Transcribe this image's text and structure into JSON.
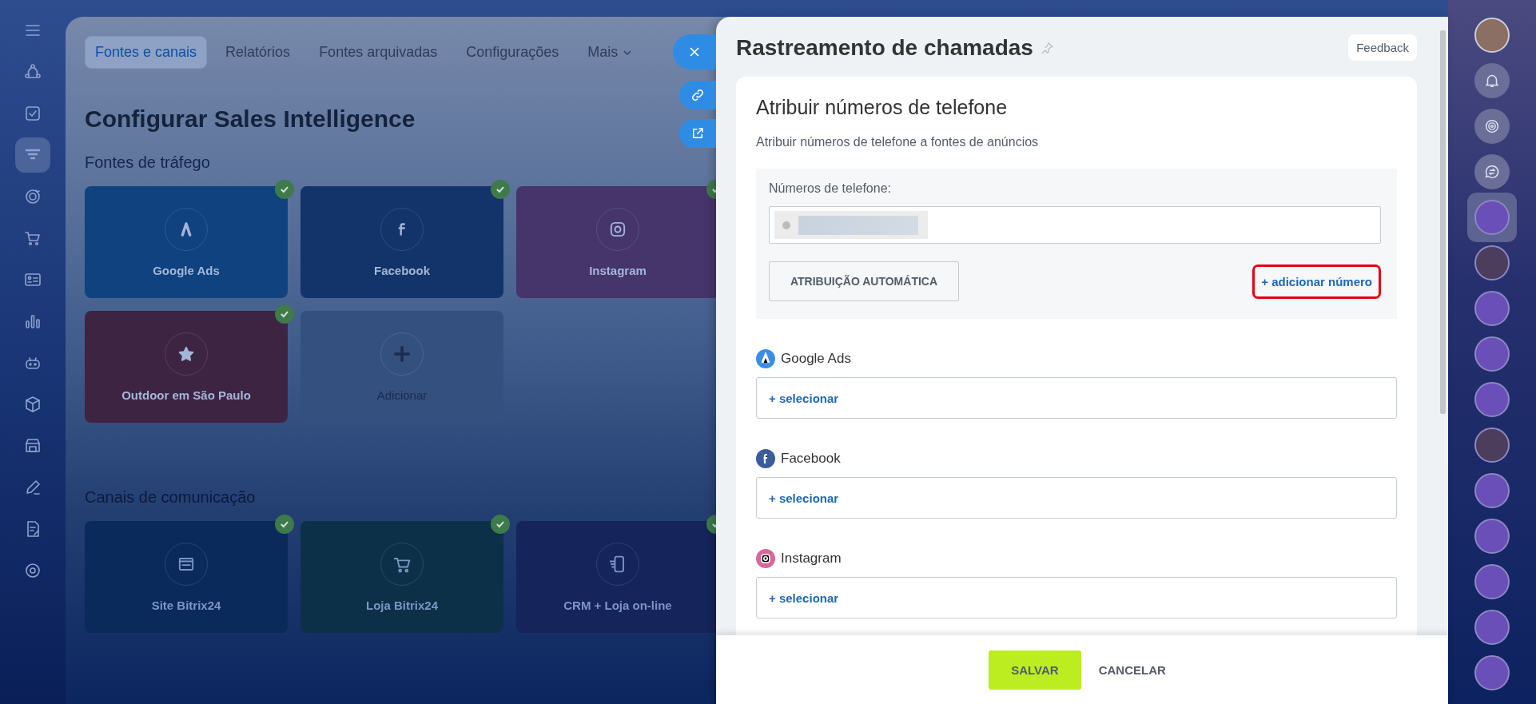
{
  "left_nav": [
    {
      "kind": "menu",
      "selected": false
    },
    {
      "kind": "nodes",
      "selected": false
    },
    {
      "kind": "task",
      "selected": false
    },
    {
      "kind": "funnel",
      "selected": true
    },
    {
      "kind": "target",
      "selected": false
    },
    {
      "kind": "cart",
      "selected": false
    },
    {
      "kind": "card",
      "selected": false
    },
    {
      "kind": "chart",
      "selected": false
    },
    {
      "kind": "robot",
      "selected": false
    },
    {
      "kind": "cube",
      "selected": false
    },
    {
      "kind": "store",
      "selected": false
    },
    {
      "kind": "pen",
      "selected": false
    },
    {
      "kind": "doc",
      "selected": false
    },
    {
      "kind": "gear",
      "selected": false
    }
  ],
  "page": {
    "tabs": [
      {
        "label": "Fontes e canais",
        "selected": true
      },
      {
        "label": "Relatórios",
        "selected": false
      },
      {
        "label": "Fontes arquivadas",
        "selected": false
      },
      {
        "label": "Configurações",
        "selected": false
      },
      {
        "label": "Mais",
        "selected": false,
        "dropdown": true
      }
    ],
    "heading": "Configurar Sales Intelligence",
    "sections": [
      {
        "title": "Fontes de tráfego",
        "cards": [
          {
            "kind": "ads",
            "label": "Google Ads",
            "checked": true,
            "color": "#10427f"
          },
          {
            "kind": "facebook",
            "label": "Facebook",
            "checked": true,
            "color": "#13336b"
          },
          {
            "kind": "instagram",
            "label": "Instagram",
            "checked": true,
            "color": "#45356b"
          },
          {
            "kind": "star",
            "label": "Outdoor em São Paulo",
            "checked": true,
            "color": "#3e2443"
          },
          {
            "kind": "add",
            "label": "Adicionar",
            "checked": false,
            "color": "#34507f"
          }
        ]
      },
      {
        "title": "Canais de comunicação",
        "cards": [
          {
            "kind": "site",
            "label": "Site Bitrix24",
            "checked": true,
            "color": "#0a2a5c"
          },
          {
            "kind": "shop",
            "label": "Loja Bitrix24",
            "checked": true,
            "color": "#0c3048"
          },
          {
            "kind": "crm",
            "label": "CRM + Loja on-line",
            "checked": true,
            "color": "#15245a"
          }
        ]
      }
    ]
  },
  "panel": {
    "title": "Rastreamento de chamadas",
    "feedback": "Feedback",
    "heading": "Atribuir números de telefone",
    "subtitle": "Atribuir números de telefone a fontes de anúncios",
    "phones": {
      "label": "Números de telefone:",
      "auto_button": "ATRIBUIÇÃO AUTOMÁTICA",
      "add_link": "+ adicionar número",
      "add_link_highlighted": true
    },
    "sources": [
      {
        "kind": "ads",
        "label": "Google Ads",
        "action": "+ selecionar"
      },
      {
        "kind": "facebook",
        "label": "Facebook",
        "action": "+ selecionar"
      },
      {
        "kind": "instagram",
        "label": "Instagram",
        "action": "+ selecionar"
      }
    ],
    "save": "SALVAR",
    "cancel": "CANCELAR"
  },
  "right_rail": [
    {
      "kind": "user",
      "selected": false
    },
    {
      "kind": "bell",
      "selected": false
    },
    {
      "kind": "copilot",
      "selected": false
    },
    {
      "kind": "chats",
      "selected": false
    },
    {
      "kind": "bot",
      "selected": true
    },
    {
      "kind": "photo",
      "selected": false
    },
    {
      "kind": "bot",
      "selected": false
    },
    {
      "kind": "bot",
      "selected": false
    },
    {
      "kind": "bot",
      "selected": false
    },
    {
      "kind": "photo",
      "selected": false
    },
    {
      "kind": "bot",
      "selected": false
    },
    {
      "kind": "bot",
      "selected": false
    },
    {
      "kind": "bot",
      "selected": false
    },
    {
      "kind": "bot",
      "selected": false
    },
    {
      "kind": "bot",
      "selected": false
    }
  ]
}
